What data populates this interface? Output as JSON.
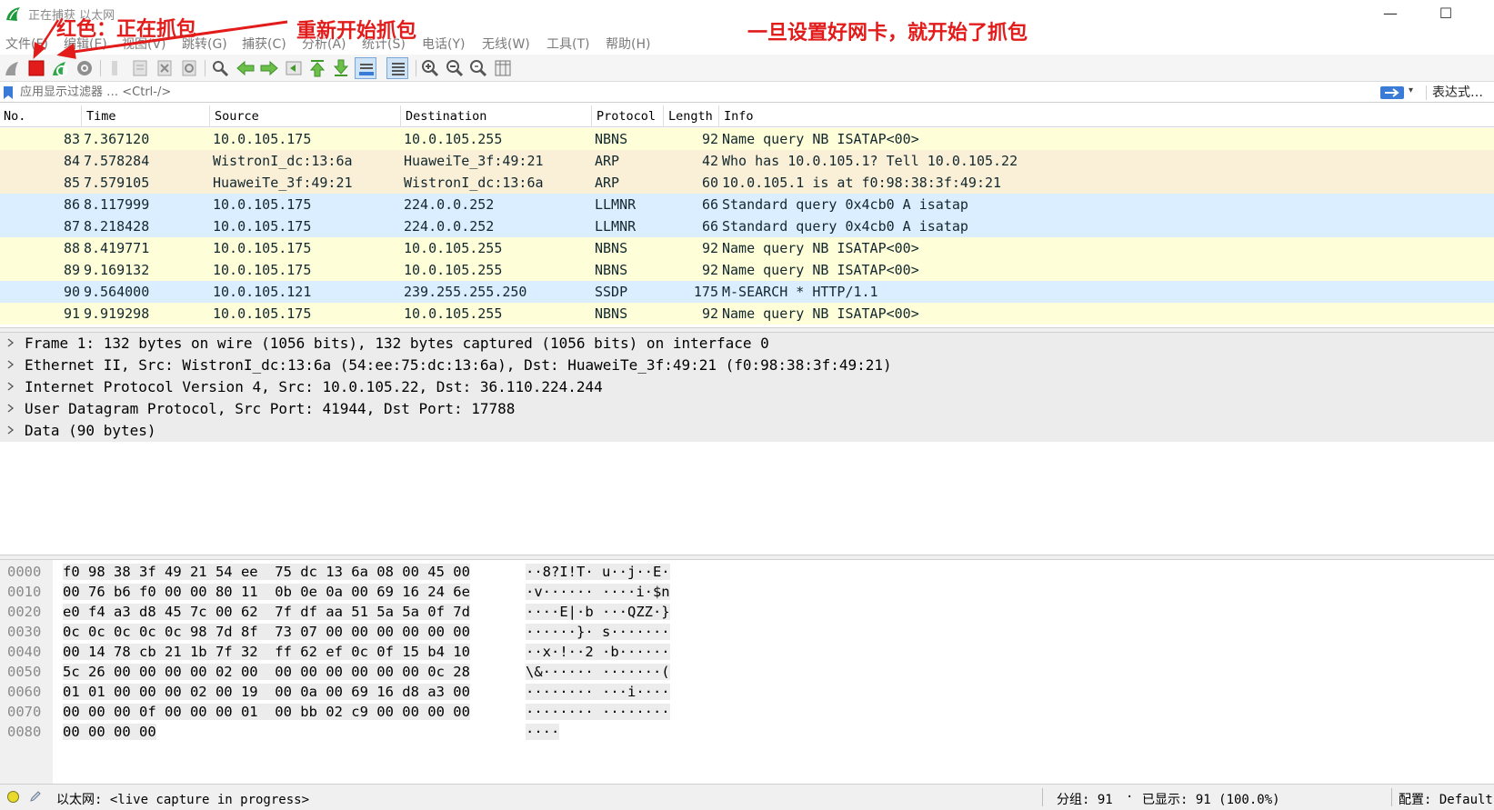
{
  "window": {
    "title": "正在捕获 以太网",
    "minimize_glyph": "—",
    "maximize_glyph": "☐"
  },
  "menu": [
    "文件(F)",
    "编辑(E)",
    "视图(V)",
    "跳转(G)",
    "捕获(C)",
    "分析(A)",
    "统计(S)",
    "电话(Y)",
    "无线(W)",
    "工具(T)",
    "帮助(H)"
  ],
  "toolbar": {
    "icons": [
      "shark-fin-start-icon",
      "stop-capture-icon",
      "restart-capture-icon",
      "capture-options-icon",
      "open-file-icon",
      "save-file-icon",
      "close-file-icon",
      "reload-file-icon",
      "find-packet-icon",
      "go-back-icon",
      "go-forward-icon",
      "go-to-packet-icon",
      "go-first-icon",
      "go-last-icon",
      "autoscroll-icon",
      "colorize-icon",
      "zoom-in-icon",
      "zoom-out-icon",
      "zoom-normal-icon",
      "resize-columns-icon"
    ],
    "colors": {
      "stop": "#e21b1b",
      "restart": "#2ea84a"
    }
  },
  "filter": {
    "placeholder": "应用显示过滤器 … <Ctrl-/>",
    "dropdown_glyph": "▾",
    "expression_label": "表达式…"
  },
  "packet_list": {
    "columns": [
      "No.",
      "Time",
      "Source",
      "Destination",
      "Protocol",
      "Length",
      "Info"
    ],
    "rows": [
      {
        "no": "83",
        "time": "7.367120",
        "src": "10.0.105.175",
        "dst": "10.0.105.255",
        "proto": "NBNS",
        "len": "92",
        "info": "Name query NB ISATAP<00>",
        "color": "#fefed8"
      },
      {
        "no": "84",
        "time": "7.578284",
        "src": "WistronI_dc:13:6a",
        "dst": "HuaweiTe_3f:49:21",
        "proto": "ARP",
        "len": "42",
        "info": "Who has 10.0.105.1? Tell 10.0.105.22",
        "color": "#faf0d7"
      },
      {
        "no": "85",
        "time": "7.579105",
        "src": "HuaweiTe_3f:49:21",
        "dst": "WistronI_dc:13:6a",
        "proto": "ARP",
        "len": "60",
        "info": "10.0.105.1 is at f0:98:38:3f:49:21",
        "color": "#faf0d7"
      },
      {
        "no": "86",
        "time": "8.117999",
        "src": "10.0.105.175",
        "dst": "224.0.0.252",
        "proto": "LLMNR",
        "len": "66",
        "info": "Standard query 0x4cb0 A isatap",
        "color": "#daeeff"
      },
      {
        "no": "87",
        "time": "8.218428",
        "src": "10.0.105.175",
        "dst": "224.0.0.252",
        "proto": "LLMNR",
        "len": "66",
        "info": "Standard query 0x4cb0 A isatap",
        "color": "#daeeff"
      },
      {
        "no": "88",
        "time": "8.419771",
        "src": "10.0.105.175",
        "dst": "10.0.105.255",
        "proto": "NBNS",
        "len": "92",
        "info": "Name query NB ISATAP<00>",
        "color": "#fefed8"
      },
      {
        "no": "89",
        "time": "9.169132",
        "src": "10.0.105.175",
        "dst": "10.0.105.255",
        "proto": "NBNS",
        "len": "92",
        "info": "Name query NB ISATAP<00>",
        "color": "#fefed8"
      },
      {
        "no": "90",
        "time": "9.564000",
        "src": "10.0.105.121",
        "dst": "239.255.255.250",
        "proto": "SSDP",
        "len": "175",
        "info": "M-SEARCH * HTTP/1.1",
        "color": "#daeeff"
      },
      {
        "no": "91",
        "time": "9.919298",
        "src": "10.0.105.175",
        "dst": "10.0.105.255",
        "proto": "NBNS",
        "len": "92",
        "info": "Name query NB ISATAP<00>",
        "color": "#fefed8"
      }
    ]
  },
  "details": [
    "Frame 1: 132 bytes on wire (1056 bits), 132 bytes captured (1056 bits) on interface 0",
    "Ethernet II, Src: WistronI_dc:13:6a (54:ee:75:dc:13:6a), Dst: HuaweiTe_3f:49:21 (f0:98:38:3f:49:21)",
    "Internet Protocol Version 4, Src: 10.0.105.22, Dst: 36.110.224.244",
    "User Datagram Protocol, Src Port: 41944, Dst Port: 17788",
    "Data (90 bytes)"
  ],
  "bytes": [
    {
      "offset": "0000",
      "hex": "f0 98 38 3f 49 21 54 ee  75 dc 13 6a 08 00 45 00",
      "ascii": "··8?I!T· u··j··E·"
    },
    {
      "offset": "0010",
      "hex": "00 76 b6 f0 00 00 80 11  0b 0e 0a 00 69 16 24 6e",
      "ascii": "·v······ ····i·$n"
    },
    {
      "offset": "0020",
      "hex": "e0 f4 a3 d8 45 7c 00 62  7f df aa 51 5a 5a 0f 7d",
      "ascii": "····E|·b ···QZZ·}"
    },
    {
      "offset": "0030",
      "hex": "0c 0c 0c 0c 0c 98 7d 8f  73 07 00 00 00 00 00 00",
      "ascii": "······}· s·······"
    },
    {
      "offset": "0040",
      "hex": "00 14 78 cb 21 1b 7f 32  ff 62 ef 0c 0f 15 b4 10",
      "ascii": "··x·!··2 ·b······"
    },
    {
      "offset": "0050",
      "hex": "5c 26 00 00 00 00 02 00  00 00 00 00 00 00 0c 28",
      "ascii": "\\&······ ·······("
    },
    {
      "offset": "0060",
      "hex": "01 01 00 00 00 02 00 19  00 0a 00 69 16 d8 a3 00",
      "ascii": "········ ···i····"
    },
    {
      "offset": "0070",
      "hex": "00 00 00 0f 00 00 00 01  00 bb 02 c9 00 00 00 00",
      "ascii": "········ ········"
    },
    {
      "offset": "0080",
      "hex": "00 00 00 00",
      "ascii": "····"
    }
  ],
  "status": {
    "interface": "以太网: <live capture in progress>",
    "packets_label": "分组: 91",
    "dot": "·",
    "displayed_label": "已显示: 91 (100.0%)",
    "profile_label": "配置: Default"
  },
  "annotations": {
    "red_label": "红色：正在抓包",
    "restart_label": "重新开始抓包",
    "note": "一旦设置好网卡，就开始了抓包",
    "color": "#e21b1b"
  }
}
